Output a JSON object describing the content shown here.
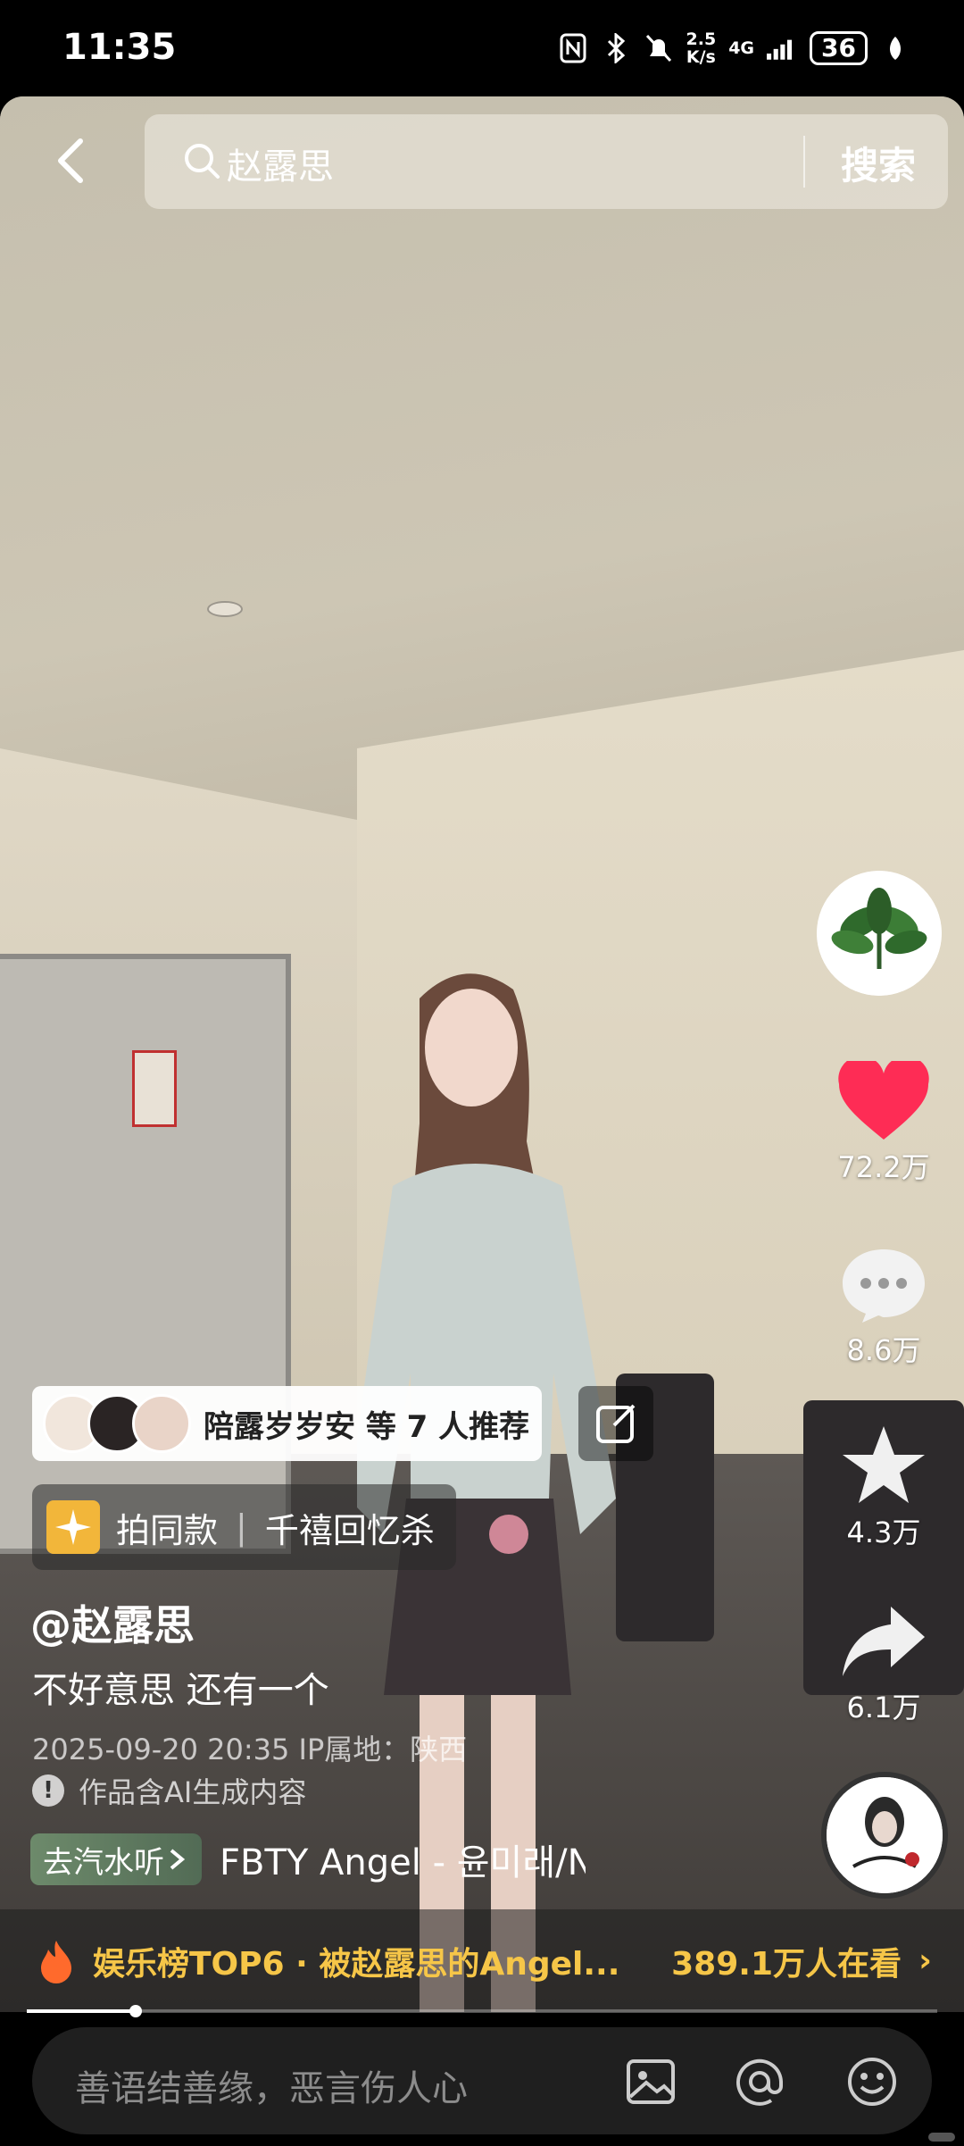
{
  "status_bar": {
    "time": "11:35",
    "net_speed_value": "2.5",
    "net_speed_unit": "K/s",
    "network": "4G",
    "battery": "36"
  },
  "search": {
    "query": "赵露思",
    "button_label": "搜索"
  },
  "side_actions": {
    "likes": "72.2万",
    "comments": "8.6万",
    "favorites": "4.3万",
    "shares": "6.1万"
  },
  "recommend": {
    "text": "陪露岁岁安 等 7 人推荐"
  },
  "same_style": {
    "label": "拍同款",
    "effect": "千禧回忆杀"
  },
  "post": {
    "author": "@赵露思",
    "caption": "不好意思 还有一个",
    "meta": "2025-09-20 20:35  IP属地：陕西",
    "ai_note": "作品含AI生成内容"
  },
  "music": {
    "listen_label": "去汽水听",
    "title": "FBTY    Angel - 윤미래/N"
  },
  "trending": {
    "text": "娱乐榜TOP6 · 被赵露思的Angel...",
    "watching": "389.1万人在看"
  },
  "progress": {
    "fraction": 0.12
  },
  "comment": {
    "placeholder": "善语结善缘，恶言伤人心"
  },
  "colors": {
    "like_red": "#fe2c55",
    "trend_gold": "#f6c648"
  }
}
